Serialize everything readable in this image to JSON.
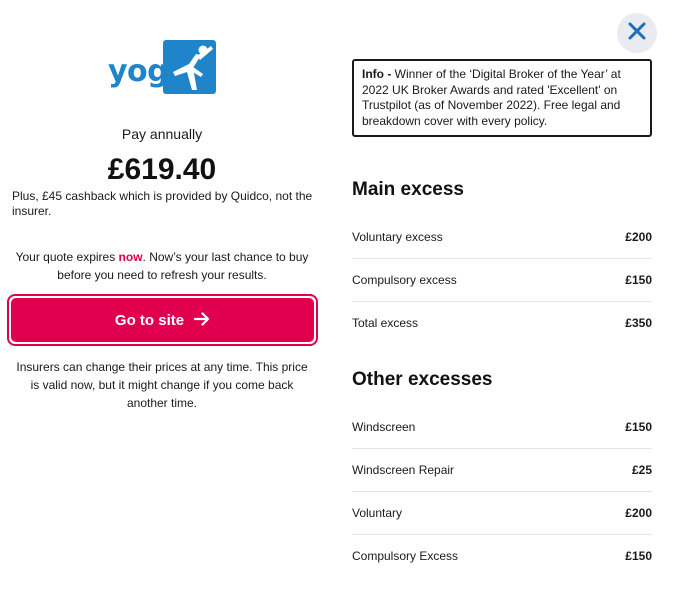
{
  "brand": {
    "name": "yoga",
    "logo_color": "#1f84c9"
  },
  "left": {
    "pay_label": "Pay annually",
    "price": "£619.40",
    "cashback": "Plus, £45 cashback which is provided by Quidco, not the insurer.",
    "expiry_prefix": "Your quote expires ",
    "expiry_now": "now",
    "expiry_suffix": ". Now’s your last chance to buy before you need to refresh your results.",
    "cta_label": "Go to site",
    "cta_color": "#e0004d",
    "disclaimer": "Insurers can change their prices at any time. This price is valid now, but it might change if you come back another time."
  },
  "info": {
    "prefix": "Info - ",
    "text": "Winner of the ‘Digital Broker of the Year’ at 2022 UK Broker Awards and rated 'Excellent' on Trustpilot (as of November 2022). Free legal and breakdown cover with every policy."
  },
  "main_excess": {
    "title": "Main excess",
    "rows": [
      {
        "label": "Voluntary excess",
        "value": "£200"
      },
      {
        "label": "Compulsory excess",
        "value": "£150"
      },
      {
        "label": "Total excess",
        "value": "£350"
      }
    ]
  },
  "other_excesses": {
    "title": "Other excesses",
    "rows": [
      {
        "label": "Windscreen",
        "value": "£150"
      },
      {
        "label": "Windscreen Repair",
        "value": "£25"
      },
      {
        "label": "Voluntary",
        "value": "£200"
      },
      {
        "label": "Compulsory Excess",
        "value": "£150"
      }
    ]
  },
  "icons": {
    "close": "close-icon",
    "arrow": "arrow-right-icon",
    "logo": "yoga-figure-icon"
  }
}
